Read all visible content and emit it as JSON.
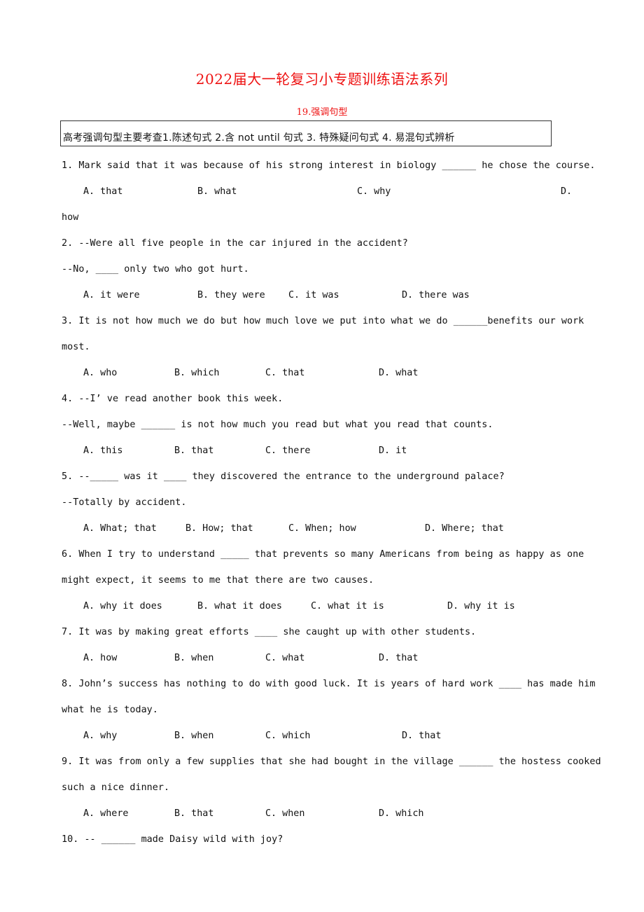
{
  "document": {
    "title": "2022届大一轮复习小专题训练语法系列",
    "subtitle": "19.强调句型",
    "summary": "高考强调句型主要考查1.陈述句式 2.含 not until 句式 3. 特殊疑问句式 4. 易混句式辨析",
    "title_color": "#ee1111"
  },
  "questions": [
    {
      "number": "1",
      "lines": [
        "1. Mark said that it was because of his strong interest in biology ______ he chose the course."
      ],
      "options": [
        "A. that",
        "B. what",
        "C. why",
        "D."
      ],
      "option_overflow": "how"
    },
    {
      "number": "2",
      "lines": [
        "2. --Were all five people in the car injured in the accident?",
        "--No, ____ only two who got hurt."
      ],
      "options": [
        "A. it were",
        "B. they were",
        "C. it was",
        "D. there was"
      ]
    },
    {
      "number": "3",
      "lines": [
        "3. It is not how much we do but how much love we put into what we do ______benefits our work",
        "most."
      ],
      "options": [
        "A. who",
        "B. which",
        "C. that",
        "D. what"
      ]
    },
    {
      "number": "4",
      "lines": [
        "4. --I’ ve read another book this week.",
        "--Well, maybe ______ is not how much you read but what you read that counts."
      ],
      "options": [
        "A. this",
        "B. that",
        "C. there",
        "D. it"
      ]
    },
    {
      "number": "5",
      "lines": [
        "5. --_____ was it ____ they discovered the entrance to the underground palace?",
        "--Totally by accident."
      ],
      "options": [
        "A. What; that",
        "B. How; that",
        "C. When; how",
        "D. Where; that"
      ]
    },
    {
      "number": "6",
      "lines": [
        "6. When I try to understand _____ that prevents so many Americans from being as happy as one",
        "might expect, it seems to me that there are two causes."
      ],
      "options": [
        "A. why it does",
        "B. what it does",
        "C. what it is",
        "D. why it is"
      ]
    },
    {
      "number": "7",
      "lines": [
        "7. It was by making great efforts ____ she caught up with other students."
      ],
      "options": [
        "A. how",
        "B. when",
        "C. what",
        "D. that"
      ]
    },
    {
      "number": "8",
      "lines": [
        "8. John’s success has nothing to do with good luck. It is years of hard work ____ has made him",
        "what he is today."
      ],
      "options": [
        "A. why",
        "B. when",
        "C. which",
        "D. that"
      ]
    },
    {
      "number": "9",
      "lines": [
        "9. It was from only a few supplies that she had bought in the village ______ the hostess cooked",
        "such a nice dinner."
      ],
      "options": [
        "A. where",
        "B. that",
        "C. when",
        "D. which"
      ]
    },
    {
      "number": "10",
      "lines": [
        "10. -- ______ made Daisy wild with joy?"
      ],
      "options": []
    }
  ]
}
